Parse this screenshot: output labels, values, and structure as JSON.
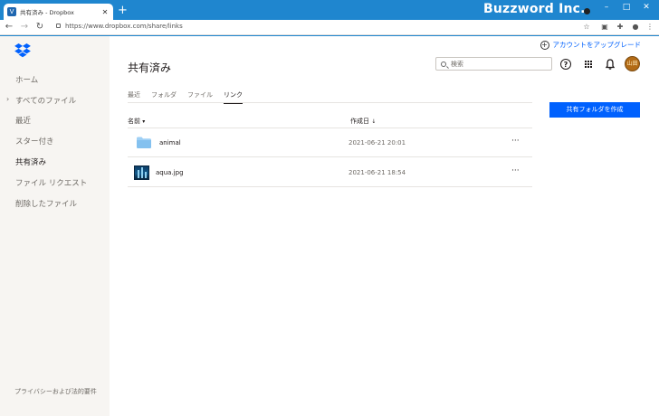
{
  "browser": {
    "tab_title": "共有済み - Dropbox",
    "tab_favicon": "V",
    "new_tab": "+",
    "brand": "Buzzword Inc.",
    "url": "https://www.dropbox.com/share/links",
    "window_controls": {
      "minimize": "–",
      "maximize": "□",
      "close": "✕"
    }
  },
  "sidebar": {
    "items": [
      {
        "label": "ホーム"
      },
      {
        "label": "すべてのファイル"
      },
      {
        "label": "最近"
      },
      {
        "label": "スター付き"
      },
      {
        "label": "共有済み"
      },
      {
        "label": "ファイル リクエスト"
      },
      {
        "label": "削除したファイル"
      }
    ],
    "active_index": 4,
    "footer": "プライバシーおよび法的要件"
  },
  "header": {
    "upgrade": "アカウントをアップグレード",
    "title": "共有済み",
    "search_placeholder": "検索",
    "avatar_text": "山田"
  },
  "tabs": [
    {
      "label": "最近"
    },
    {
      "label": "フォルダ"
    },
    {
      "label": "ファイル"
    },
    {
      "label": "リンク"
    }
  ],
  "active_tab": 3,
  "create_button": "共有フォルダを作成",
  "table": {
    "columns": {
      "name": "名前",
      "name_sort": "▾",
      "created": "作成日",
      "created_sort": "↓"
    },
    "rows": [
      {
        "name": "animal",
        "date": "2021-06-21 20:01",
        "kind": "folder"
      },
      {
        "name": "aqua.jpg",
        "date": "2021-06-21 18:54",
        "kind": "image"
      }
    ],
    "more": "···"
  },
  "colors": {
    "accent": "#0061fe",
    "titlebar": "#1f86cf",
    "sidebar": "#f7f5f2"
  }
}
